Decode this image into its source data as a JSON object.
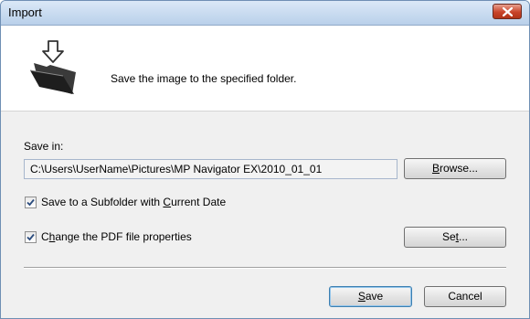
{
  "window": {
    "title": "Import",
    "close_icon": "close-icon"
  },
  "header": {
    "icon": "save-to-folder-icon",
    "message": "Save the image to the specified folder."
  },
  "save_in": {
    "label": "Save in:",
    "path": "C:\\Users\\UserName\\Pictures\\MP Navigator EX\\2010_01_01",
    "browse_pre": "",
    "browse_acc": "B",
    "browse_post": "rowse..."
  },
  "subfolder": {
    "checked": true,
    "pre": "Save to a Subfolder with ",
    "acc": "C",
    "post": "urrent Date"
  },
  "pdf_props": {
    "checked": true,
    "pre": "C",
    "acc": "h",
    "post": "ange the PDF file properties",
    "set_pre": "Se",
    "set_acc": "t",
    "set_post": "..."
  },
  "footer": {
    "save_pre": "",
    "save_acc": "S",
    "save_post": "ave",
    "cancel": "Cancel"
  }
}
